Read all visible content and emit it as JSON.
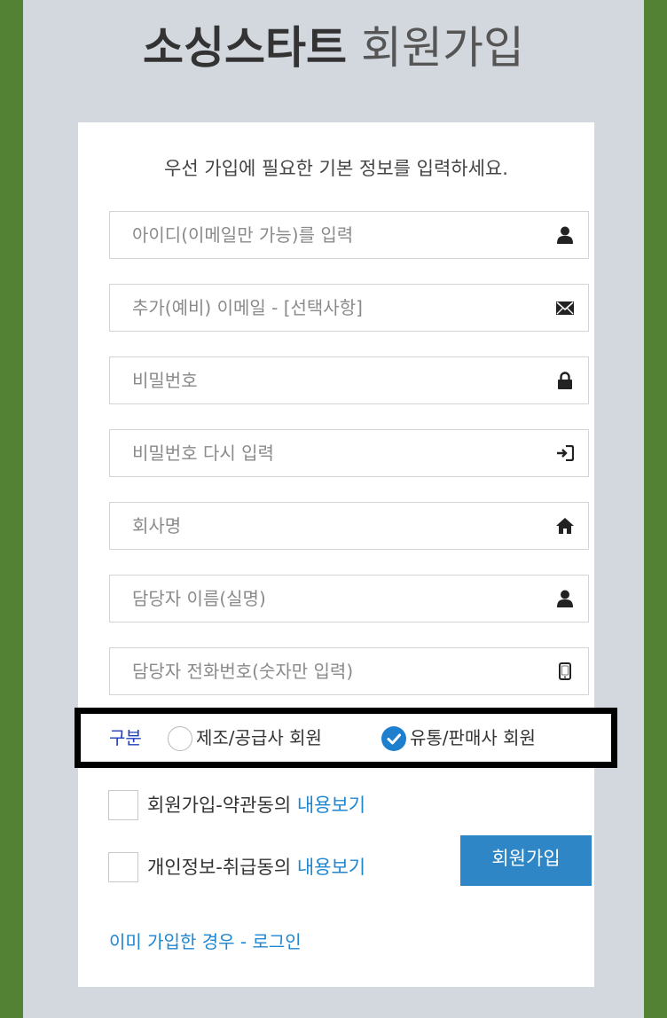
{
  "title": {
    "strong": "소싱스타트",
    "light": "회원가입"
  },
  "intro": "우선 가입에 필요한 기본 정보를 입력하세요.",
  "fields": [
    {
      "placeholder": "아이디(이메일만 가능)를 입력",
      "icon": "user-icon"
    },
    {
      "placeholder": "추가(예비) 이메일 - [선택사항]",
      "icon": "envelope-icon"
    },
    {
      "placeholder": "비밀번호",
      "icon": "lock-icon"
    },
    {
      "placeholder": "비밀번호 다시 입력",
      "icon": "login-icon"
    },
    {
      "placeholder": "회사명",
      "icon": "home-icon"
    },
    {
      "placeholder": "담당자 이름(실명)",
      "icon": "user-icon"
    },
    {
      "placeholder": "담당자 전화번호(숫자만 입력)",
      "icon": "phone-icon"
    }
  ],
  "member_type": {
    "label": "구분",
    "options": [
      {
        "label": "제조/공급사 회원",
        "selected": false
      },
      {
        "label": "유통/판매사 회원",
        "selected": true
      }
    ]
  },
  "agreements": [
    {
      "text": "회원가입-약관동의",
      "link": "내용보기",
      "checked": false
    },
    {
      "text": "개인정보-취급동의",
      "link": "내용보기",
      "checked": false
    }
  ],
  "submit_label": "회원가입",
  "login_link": "이미 가입한 경우 - 로그인",
  "colors": {
    "outer_background": "#548235",
    "page_background": "#d3d7de",
    "accent": "#2f86c6",
    "link": "#1f86d0",
    "label_blue": "#1f3fbf"
  }
}
